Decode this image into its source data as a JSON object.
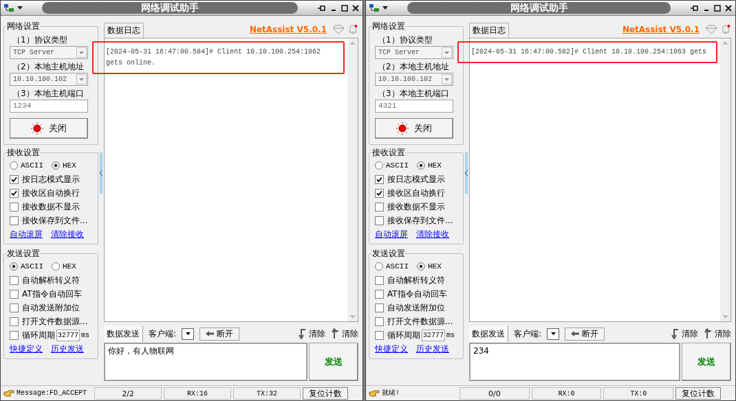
{
  "windows": [
    {
      "title": "网络调试助手",
      "network": {
        "title": "网络设置",
        "fields": [
          {
            "label": "（1）协议类型",
            "kind": "select",
            "value": "TCP Server",
            "disabled": true
          },
          {
            "label": "（2）本地主机地址",
            "kind": "select",
            "value": "10.10.100.102",
            "disabled": true
          },
          {
            "label": "（3）本地主机端口",
            "kind": "input",
            "value": "1234",
            "disabled": true
          }
        ],
        "button": "关闭"
      },
      "receive": {
        "title": "接收设置",
        "encoding": [
          {
            "label": "ASCII",
            "selected": false
          },
          {
            "label": "HEX",
            "selected": true
          }
        ],
        "checks": [
          {
            "label": "按日志模式显示",
            "checked": true
          },
          {
            "label": "接收区自动换行",
            "checked": true
          },
          {
            "label": "接收数据不显示",
            "checked": false
          },
          {
            "label": "接收保存到文件...",
            "checked": false
          }
        ],
        "links": [
          "自动滚屏",
          "清除接收"
        ]
      },
      "send": {
        "title": "发送设置",
        "encoding": [
          {
            "label": "ASCII",
            "selected": true
          },
          {
            "label": "HEX",
            "selected": false
          }
        ],
        "checks": [
          {
            "label": "自动解析转义符",
            "checked": false
          },
          {
            "label": "AT指令自动回车",
            "checked": false
          },
          {
            "label": "自动发送附加位",
            "checked": false
          },
          {
            "label": "打开文件数据源...",
            "checked": false
          }
        ],
        "cycle": {
          "label": "循环周期",
          "checked": false,
          "value": "32777",
          "unit": "ms"
        },
        "links": [
          "快捷定义",
          "历史发送"
        ]
      },
      "log_tab": "数据日志",
      "brand": "NetAssist V5.0.1",
      "log": {
        "highlighted": true,
        "lines": [
          "[2024-05-31 16:47:00.584]# Client 10.10.100.254:1062",
          "gets online."
        ]
      },
      "send_bar": {
        "tab": "数据发送",
        "client_label": "客户端:",
        "disconnect": "断开",
        "clear_buttons": [
          "清除",
          "清除"
        ],
        "input": "你好，有人物联网",
        "send": "发送"
      },
      "status": {
        "message": "Message:FD_ACCEPT",
        "count": "2/2",
        "rx": "RX:16",
        "tx": "TX:32",
        "reset": "复位计数"
      }
    },
    {
      "title": "网络调试助手",
      "network": {
        "title": "网络设置",
        "fields": [
          {
            "label": "（1）协议类型",
            "kind": "select",
            "value": "TCP Server",
            "disabled": true
          },
          {
            "label": "（2）本地主机地址",
            "kind": "select",
            "value": "10.10.100.102",
            "disabled": true
          },
          {
            "label": "（3）本地主机端口",
            "kind": "input",
            "value": "4321",
            "disabled": true
          }
        ],
        "button": "关闭"
      },
      "receive": {
        "title": "接收设置",
        "encoding": [
          {
            "label": "ASCII",
            "selected": false
          },
          {
            "label": "HEX",
            "selected": true
          }
        ],
        "checks": [
          {
            "label": "按日志模式显示",
            "checked": true
          },
          {
            "label": "接收区自动换行",
            "checked": true
          },
          {
            "label": "接收数据不显示",
            "checked": false
          },
          {
            "label": "接收保存到文件...",
            "checked": false
          }
        ],
        "links": [
          "自动滚屏",
          "清除接收"
        ]
      },
      "send": {
        "title": "发送设置",
        "encoding": [
          {
            "label": "ASCII",
            "selected": false
          },
          {
            "label": "HEX",
            "selected": true
          }
        ],
        "checks": [
          {
            "label": "自动解析转义符",
            "checked": false
          },
          {
            "label": "AT指令自动回车",
            "checked": false
          },
          {
            "label": "自动发送附加位",
            "checked": false
          },
          {
            "label": "打开文件数据源...",
            "checked": false
          }
        ],
        "cycle": {
          "label": "循环周期",
          "checked": false,
          "value": "32777",
          "unit": "ms"
        },
        "links": [
          "快捷定义",
          "历史发送"
        ]
      },
      "log_tab": "数据日志",
      "brand": "NetAssist V5.0.1",
      "log": {
        "highlighted": true,
        "lines": [
          "[2024-05-31 16:47:00.582]# Client 10.10.100.254:1063 gets"
        ]
      },
      "send_bar": {
        "tab": "数据发送",
        "client_label": "客户端:",
        "disconnect": "断开",
        "clear_buttons": [
          "清除",
          "清除"
        ],
        "input": "234",
        "send": "发送"
      },
      "status": {
        "message": "就绪!",
        "count": "0/0",
        "rx": "RX:0",
        "tx": "TX:0",
        "reset": "复位计数"
      }
    }
  ]
}
